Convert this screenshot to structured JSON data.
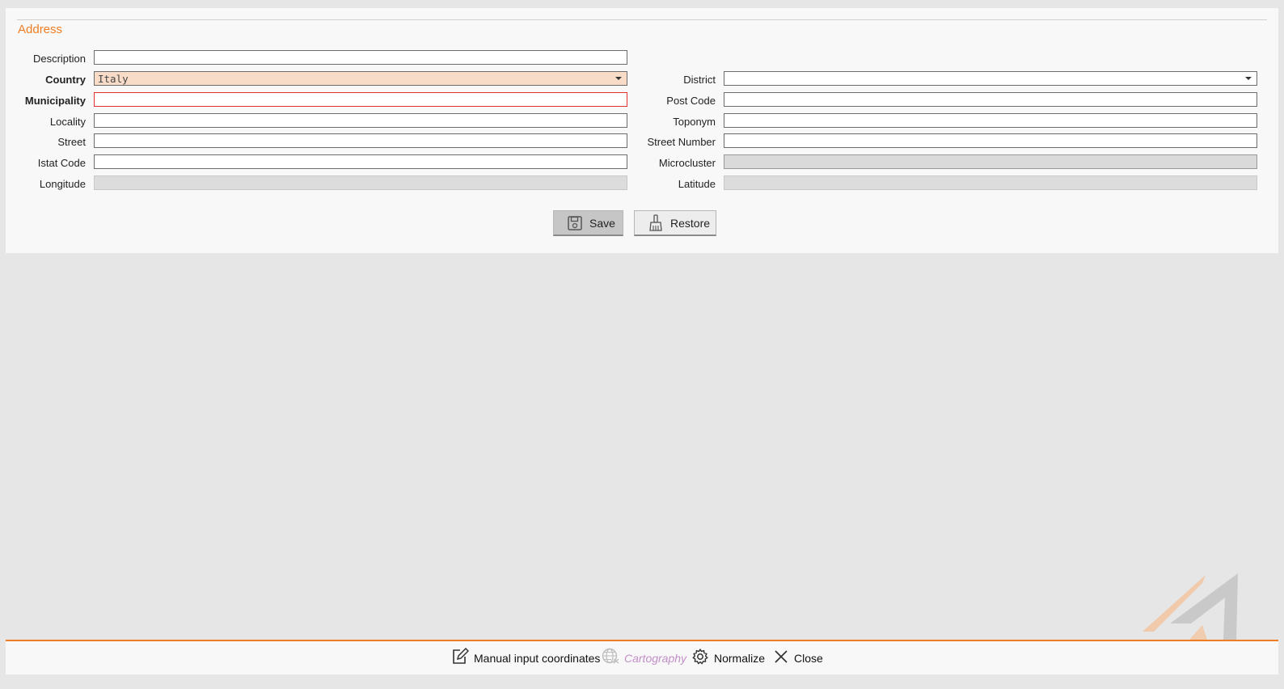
{
  "section": {
    "title": "Address"
  },
  "fields": {
    "description": {
      "label": "Description",
      "value": ""
    },
    "country": {
      "label": "Country",
      "value": "Italy"
    },
    "district": {
      "label": "District",
      "value": ""
    },
    "municipality": {
      "label": "Municipality",
      "value": ""
    },
    "post_code": {
      "label": "Post Code",
      "value": ""
    },
    "locality": {
      "label": "Locality",
      "value": ""
    },
    "toponym": {
      "label": "Toponym",
      "value": ""
    },
    "street": {
      "label": "Street",
      "value": ""
    },
    "street_number": {
      "label": "Street Number",
      "value": ""
    },
    "istat_code": {
      "label": "Istat Code",
      "value": ""
    },
    "microcluster": {
      "label": "Microcluster",
      "value": ""
    },
    "longitude": {
      "label": "Longitude",
      "value": ""
    },
    "latitude": {
      "label": "Latitude",
      "value": ""
    }
  },
  "buttons": {
    "save": "Save",
    "restore": "Restore"
  },
  "footer": {
    "manual_input": "Manual input coordinates",
    "cartography": "Cartography",
    "normalize": "Normalize",
    "close": "Close"
  },
  "colors": {
    "accent": "#ef7d22",
    "error_border": "#e0302f",
    "country_bg": "#f8dcc8",
    "disabled_text": "#c28ec8"
  },
  "icons": {
    "save": "floppy-disk-icon",
    "restore": "broom-icon",
    "manual_input": "edit-icon",
    "cartography": "globe-icon",
    "normalize": "gear-icon",
    "close": "close-icon"
  }
}
